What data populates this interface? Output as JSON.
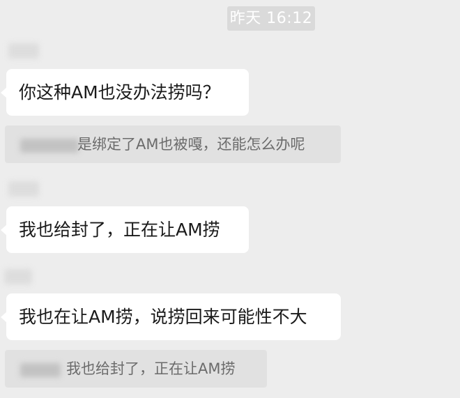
{
  "chat": {
    "timestamp": "昨天 16:12",
    "messages": [
      {
        "text": "你这种AM也没办法捞吗？"
      },
      {
        "text": "我也给封了，正在让AM捞"
      },
      {
        "text": "我也在让AM捞，说捞回来可能性不大"
      }
    ],
    "quotes": [
      {
        "text": "是绑定了AM也被嘎，还能怎么办呢"
      },
      {
        "text": "我也给封了，正在让AM捞"
      }
    ]
  }
}
